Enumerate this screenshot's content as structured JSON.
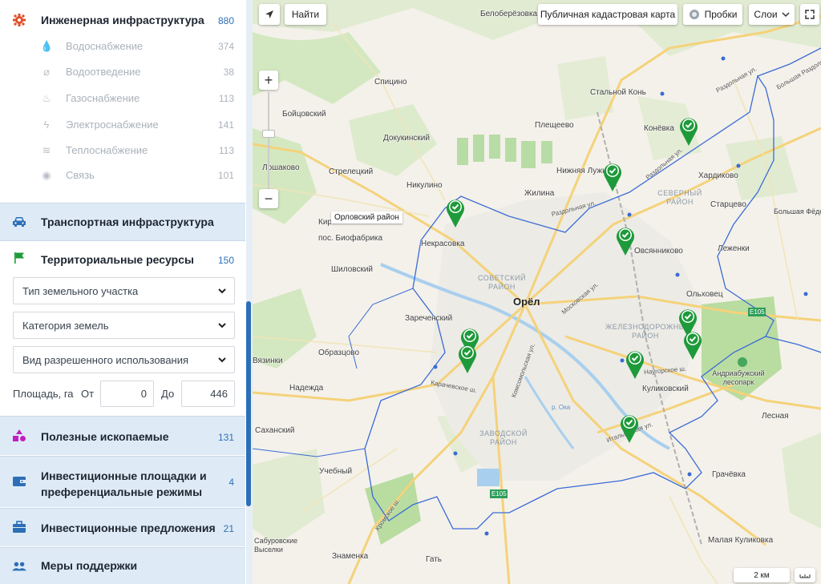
{
  "sidebar": {
    "engineering": {
      "title": "Инженерная инфраструктура",
      "count": "880",
      "items": [
        {
          "label": "Водоснабжение",
          "count": "374",
          "icon": "water-drop-icon"
        },
        {
          "label": "Водоотведение",
          "count": "38",
          "icon": "drain-icon"
        },
        {
          "label": "Газоснабжение",
          "count": "113",
          "icon": "flame-icon"
        },
        {
          "label": "Электроснабжение",
          "count": "141",
          "icon": "lightning-icon"
        },
        {
          "label": "Теплоснабжение",
          "count": "113",
          "icon": "heat-icon"
        },
        {
          "label": "Связь",
          "count": "101",
          "icon": "signal-icon"
        }
      ]
    },
    "transport": {
      "title": "Транспортная инфраструктура"
    },
    "territorial": {
      "title": "Территориальные ресурсы",
      "count": "150",
      "filters": {
        "plot_type": "Тип земельного участка",
        "land_category": "Категория земель",
        "permitted_use": "Вид разрешенного использования"
      },
      "area": {
        "label": "Площадь, га",
        "from_label": "От",
        "from_value": "0",
        "to_label": "До",
        "to_value": "446"
      }
    },
    "minerals": {
      "title": "Полезные ископаемые",
      "count": "131"
    },
    "invest_sites": {
      "title_line1": "Инвестиционные площадки и",
      "title_line2": "преференциальные режимы",
      "count": "4"
    },
    "invest_offers": {
      "title": "Инвестиционные предложения",
      "count": "21"
    },
    "support": {
      "title": "Меры поддержки"
    }
  },
  "map": {
    "toolbar": {
      "find": "Найти",
      "cadastral": "Публичная кадастровая карта",
      "traffic": "Пробки",
      "layers": "Слои"
    },
    "tooltip": "Орловский район",
    "city": "Орёл",
    "scale": "2 км",
    "places": [
      "Белоберёзовка",
      "Стальной Конь",
      "Спицино",
      "Бойцовский",
      "Плещеево",
      "Конёвка",
      "Докукинский",
      "Лошаково",
      "Стрелецкий",
      "Никулино",
      "Жилина",
      "Нижняя Лужна",
      "Хардиково",
      "Старцево",
      "Большая Фёдоровка",
      "Кир",
      "пос. Биофабрика",
      "Некрасовка",
      "Овсянниково",
      "Леженки",
      "Шиловский",
      "Ольховец",
      "Зареченский",
      "Образцово",
      "Вязинки",
      "Надежда",
      "Куликовский",
      "Андриабужский лесопарк",
      "Лесная",
      "Саханский",
      "Учебный",
      "Грачёвка",
      "Сабуровские Выселки",
      "Знаменка",
      "Гать",
      "Малая Куликовка"
    ],
    "districts": [
      "СЕВЕРНЫЙ РАЙОН",
      "СОВЕТСКИЙ РАЙОН",
      "ЖЕЛЕЗНОДОРОЖНЫЙ РАЙОН",
      "ЗАВОДСКОЙ РАЙОН"
    ],
    "streets": [
      "Раздольная ул.",
      "Раздольная ул.",
      "Раздольная ул.",
      "Московская ул.",
      "Комсомольская ул.",
      "Карачевское ш.",
      "Наугорское ш.",
      "Кромское ш.",
      "Итальянская ул.",
      "р. Ока",
      "Большая Раздольная ул."
    ],
    "roads": [
      "E105",
      "E105"
    ],
    "colors": {
      "marker": "#1e9a3a",
      "boundary": "#3a6bd6",
      "accent": "#2d6fb7"
    }
  }
}
